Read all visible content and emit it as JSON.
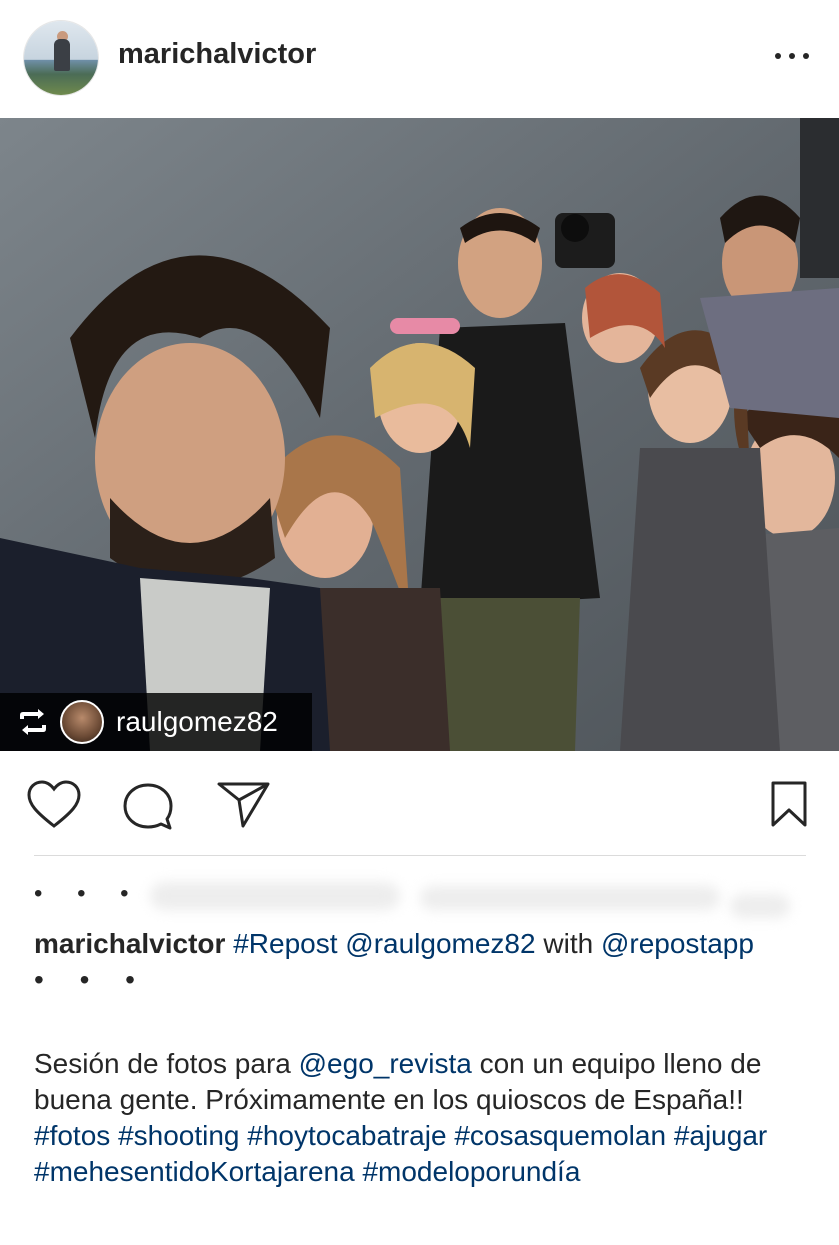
{
  "header": {
    "username": "marichalvictor",
    "more_icon": "more-horizontal-icon"
  },
  "photo": {
    "repost_icon": "repost-icon",
    "repost_user": "raulgomez82"
  },
  "actions": {
    "like_icon": "heart-icon",
    "comment_icon": "comment-icon",
    "share_icon": "send-icon",
    "save_icon": "bookmark-icon"
  },
  "caption": {
    "author": "marichalvictor",
    "tag_repost": "#Repost",
    "mention_user": "@raulgomez82",
    "with_text": "with",
    "mention_app": "@repostapp",
    "dots": "• • •",
    "body_part1": "Sesión de fotos para",
    "mention_ego": "@ego_revista",
    "body_part2": "con un equipo lleno de buena gente. Próximamente en los quioscos de España!!",
    "hashtags": [
      "#fotos",
      "#shooting",
      "#hoytocabatraje",
      "#cosasquemolan",
      "#ajugar",
      "#mehesentidoKortajarena",
      "#modeloporundía"
    ]
  },
  "colors": {
    "link": "#003569",
    "text": "#262626",
    "divider": "#dbdbdb"
  }
}
